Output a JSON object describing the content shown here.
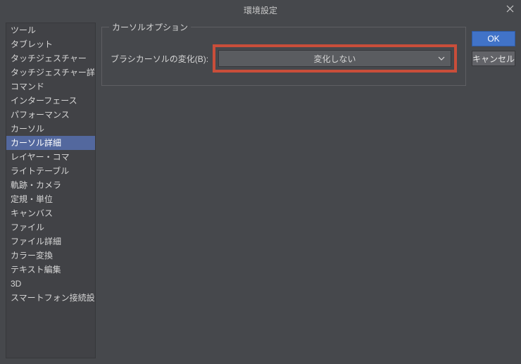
{
  "dialog": {
    "title": "環境設定"
  },
  "sidebar": {
    "items": [
      {
        "label": "ツール"
      },
      {
        "label": "タブレット"
      },
      {
        "label": "タッチジェスチャー"
      },
      {
        "label": "タッチジェスチャー詳細"
      },
      {
        "label": "コマンド"
      },
      {
        "label": "インターフェース"
      },
      {
        "label": "パフォーマンス"
      },
      {
        "label": "カーソル"
      },
      {
        "label": "カーソル詳細"
      },
      {
        "label": "レイヤー・コマ"
      },
      {
        "label": "ライトテーブル"
      },
      {
        "label": "軌跡・カメラ"
      },
      {
        "label": "定規・単位"
      },
      {
        "label": "キャンバス"
      },
      {
        "label": "ファイル"
      },
      {
        "label": "ファイル詳細"
      },
      {
        "label": "カラー変換"
      },
      {
        "label": "テキスト編集"
      },
      {
        "label": "3D"
      },
      {
        "label": "スマートフォン接続設定"
      }
    ],
    "selectedIndex": 8
  },
  "main": {
    "fieldset_title": "カーソルオプション",
    "brush_cursor_label": "ブラシカーソルの変化(B):",
    "brush_cursor_value": "変化しない"
  },
  "buttons": {
    "ok": "OK",
    "cancel": "キャンセル"
  }
}
